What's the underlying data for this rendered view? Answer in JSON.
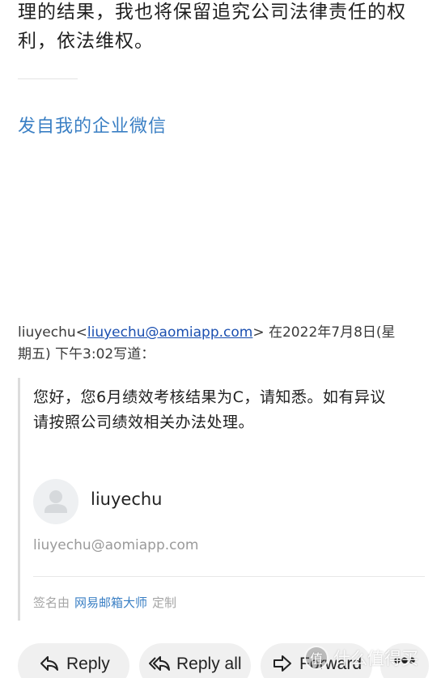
{
  "message": {
    "tail_lines": [
      "理的结果，我也将保留追究公司法律责任的权",
      "利，依法维权。"
    ],
    "sent_from_link": "发自我的企业微信"
  },
  "quote_header": {
    "sender_name": "liuyechu",
    "lt": "<",
    "sender_email": "liuyechu@aomiapp.com",
    "gt_date": "> 在2022年7月8日(星",
    "line2": "期五) 下午3:02写道："
  },
  "quoted": {
    "lines": [
      "您好，您6月绩效考核结果为C，请知悉。如有异议",
      "请按照公司绩效相关办法处理。"
    ]
  },
  "signature": {
    "name": "liuyechu",
    "email": "liuyechu@aomiapp.com",
    "footer_prefix": "签名由",
    "footer_brand": "网易邮箱大师",
    "footer_suffix": "定制"
  },
  "actions": {
    "reply_label": "Reply",
    "reply_all_label": "Reply all",
    "forward_label": "Forward",
    "more_label": "•••"
  },
  "watermark": {
    "badge": "值",
    "text": "什么值得买"
  },
  "colors": {
    "link": "#3a7fc4",
    "email_link": "#1a4fb0",
    "button_bg": "#f0f0f0"
  }
}
